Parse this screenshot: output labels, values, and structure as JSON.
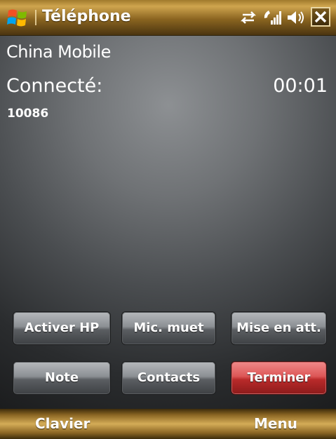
{
  "title_bar": {
    "title": "Téléphone",
    "icons": [
      "windows-start-icon",
      "connectivity-icon",
      "signal-icon",
      "volume-icon",
      "close-icon"
    ]
  },
  "call": {
    "carrier": "China Mobile",
    "state": "Connecté:",
    "timer": "00:01",
    "number": "10086"
  },
  "buttons": {
    "speaker": "Activer HP",
    "mute": "Mic. muet",
    "hold": "Mise en att.",
    "note": "Note",
    "contacts": "Contacts",
    "end_call": "Terminer"
  },
  "softkeys": {
    "left": "Clavier",
    "right": "Menu"
  },
  "colors": {
    "title_bar": "#b08a3a",
    "end_call": "#d94a4a"
  }
}
